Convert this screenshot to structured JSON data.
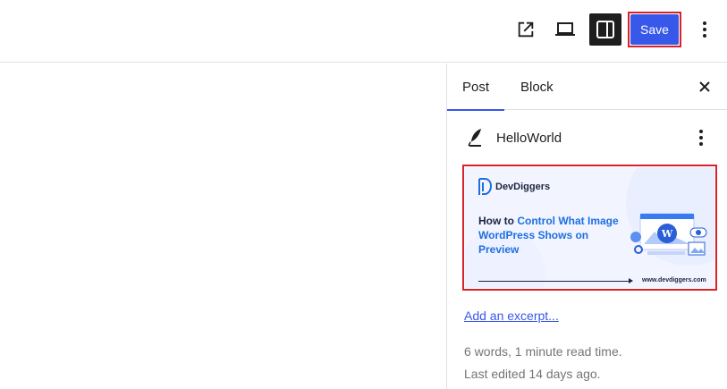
{
  "toolbar": {
    "view_icon": "external-link-icon",
    "preview_icon": "laptop-icon",
    "settings_icon": "sidebar-toggle-icon",
    "save_label": "Save",
    "more_icon": "vertical-ellipsis-icon"
  },
  "sidebar": {
    "tabs": [
      {
        "label": "Post",
        "active": true
      },
      {
        "label": "Block",
        "active": false
      }
    ],
    "close_icon": "close-icon",
    "post": {
      "icon": "quill-icon",
      "title": "HelloWorld",
      "more_icon": "vertical-ellipsis-icon"
    },
    "featured_image": {
      "brand": "DevDiggers",
      "headline_prefix": "How to ",
      "headline_highlight": "Control What Image WordPress Shows on Preview",
      "url": "www.devdiggers.com"
    },
    "excerpt_link": "Add an excerpt...",
    "stats": "6 words, 1 minute read time.",
    "last_edited": "Last edited 14 days ago."
  },
  "colors": {
    "accent": "#3858e9",
    "highlight_border": "#d92128",
    "muted_text": "#757575"
  }
}
